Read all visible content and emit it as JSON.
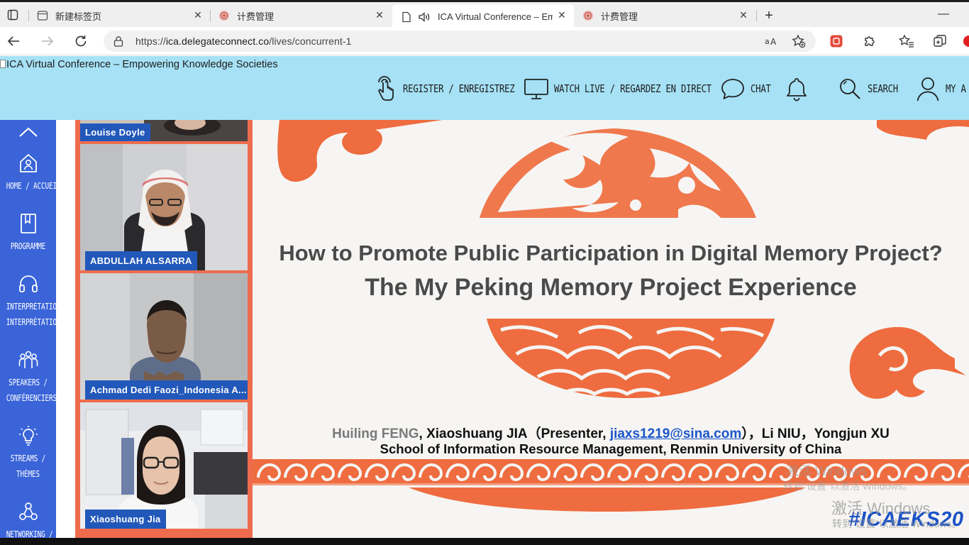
{
  "browser": {
    "tabs": [
      {
        "title": "新建标签页",
        "active": false
      },
      {
        "title": "计费管理",
        "active": false
      },
      {
        "title": "ICA Virtual Conference – Em",
        "active": true
      },
      {
        "title": "计费管理",
        "active": false
      }
    ],
    "close_glyph": "✕",
    "new_tab_glyph": "+",
    "minimize_glyph": "—",
    "url": {
      "scheme": "https://",
      "host": "ica.delegateconnect.co",
      "path": "/lives/concurrent-1"
    },
    "colors": {
      "accent": "#e34b3c",
      "tab_bar": "#efefef"
    }
  },
  "site": {
    "title": "ICA Virtual Conference – Empowering Knowledge Societies",
    "header_color": "#a6e1f5",
    "nav": {
      "register": "REGISTER / ENREGISTREZ",
      "watch": "WATCH LIVE / REGARDEZ EN DIRECT",
      "chat": "CHAT",
      "search": "SEARCH",
      "account": "MY A"
    },
    "sidebar_color": "#3a64d8",
    "sidebar": [
      {
        "line1": "HOME / ACCUEIL",
        "line2": ""
      },
      {
        "line1": "PROGRAMME",
        "line2": ""
      },
      {
        "line1": "INTERPRETATION /",
        "line2": "INTERPRÉTATION"
      },
      {
        "line1": "SPEAKERS /",
        "line2": "CONFÉRENCIERS"
      },
      {
        "line1": "STREAMS /",
        "line2": "THÈMES"
      },
      {
        "line1": "NETWORKING /",
        "line2": ""
      }
    ]
  },
  "meeting": {
    "participants": [
      {
        "name": "Louise Doyle"
      },
      {
        "name": "ABDULLAH ALSARRA"
      },
      {
        "name": "Achmad Dedi Faozi_Indonesia A..."
      },
      {
        "name": "Xiaoshuang Jia"
      }
    ],
    "slide": {
      "title_line1": "How to Promote Public Participation in Digital Memory Project?",
      "title_line2": "The My Peking Memory Project Experience",
      "author1": "Huiling FENG",
      "author2": ", Xiaoshuang JIA（Presenter, ",
      "email": "jiaxs1219@sina.com",
      "author_rest": "），Li NIU，Yongjun XU",
      "affiliation": "School of Information Resource Management, Renmin University of China",
      "hashtag": "#ICAEKS20",
      "accent_color": "#ee6c3f"
    }
  },
  "watermarks": {
    "a_line1": "激活 Windows",
    "a_line2": "转到\"设置\"以激活 Windows。",
    "b_line1": "激活 Windows",
    "b_line2": "转到\"设置\"以激活 Windows。"
  }
}
